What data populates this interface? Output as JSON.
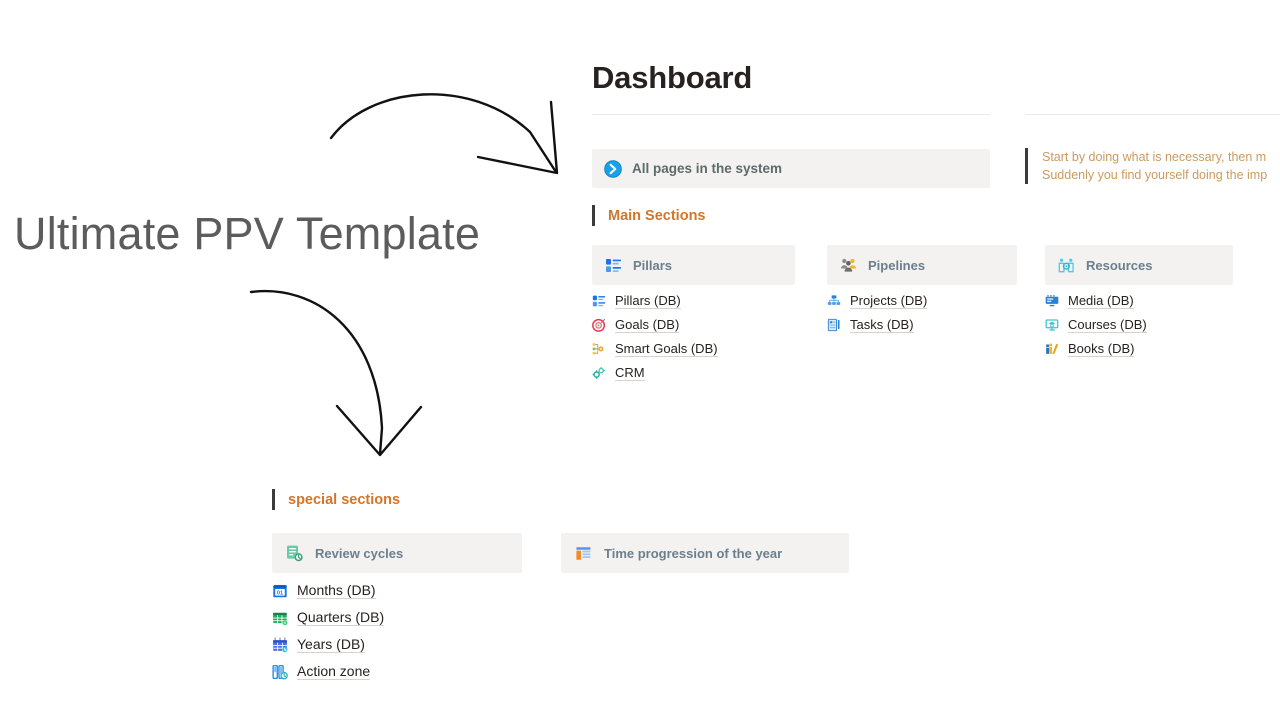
{
  "promo": {
    "title": "Ultimate PPV Template",
    "arrow_top": "curved-arrow-right",
    "arrow_bottom": "curved-arrow-down"
  },
  "document": {
    "page_title": "Dashboard",
    "callout": {
      "icon": "blue-circle-arrow-icon",
      "label": "All pages in the system"
    },
    "quote": {
      "line1": "Start by doing what is necessary, then m",
      "line2": "Suddenly you find yourself doing the imp",
      "color": "#cc9a5c"
    },
    "headings": {
      "main_sections": "Main Sections",
      "special_sections": "special sections"
    },
    "main_sections": [
      {
        "header": {
          "label": "Pillars",
          "icon": "blue-list-icon"
        },
        "links": [
          {
            "label": "Pillars (DB)",
            "icon": "blue-list-icon"
          },
          {
            "label": "Goals (DB)",
            "icon": "red-target-icon"
          },
          {
            "label": "Smart Goals (DB)",
            "icon": "yellow-flowchart-icon"
          },
          {
            "label": "CRM",
            "icon": "teal-gears-icon"
          }
        ]
      },
      {
        "header": {
          "label": "Pipelines",
          "icon": "gray-people-group-icon"
        },
        "links": [
          {
            "label": "Projects (DB)",
            "icon": "blue-org-chart-icon"
          },
          {
            "label": "Tasks (DB)",
            "icon": "blue-task-list-icon"
          }
        ]
      },
      {
        "header": {
          "label": "Resources",
          "icon": "cyan-people-gear-icon"
        },
        "links": [
          {
            "label": "Media (DB)",
            "icon": "blue-media-screen-icon"
          },
          {
            "label": "Courses (DB)",
            "icon": "cyan-monitor-icon"
          },
          {
            "label": "Books (DB)",
            "icon": "yellow-books-icon"
          }
        ]
      }
    ],
    "special_sections": [
      {
        "header": {
          "label": "Review cycles",
          "icon": "green-review-icon"
        },
        "links": [
          {
            "label": "Months (DB)",
            "icon": "blue-calendar-01-icon"
          },
          {
            "label": "Quarters (DB)",
            "icon": "green-spreadsheet-icon"
          },
          {
            "label": "Years (DB)",
            "icon": "purple-calendar-grid-icon"
          },
          {
            "label": "Action zone",
            "icon": "teal-columns-clock-icon"
          }
        ]
      },
      {
        "header": {
          "label": "Time progression of the year",
          "icon": "orange-bar-chart-icon"
        },
        "links": []
      }
    ]
  },
  "colors": {
    "accent_orange": "#d2762a",
    "card_bg": "#f3f2f0",
    "header_text": "#6c7f8c",
    "body_text": "#272220",
    "quote_text": "#cc9a5c",
    "divider": "#eceae8"
  }
}
